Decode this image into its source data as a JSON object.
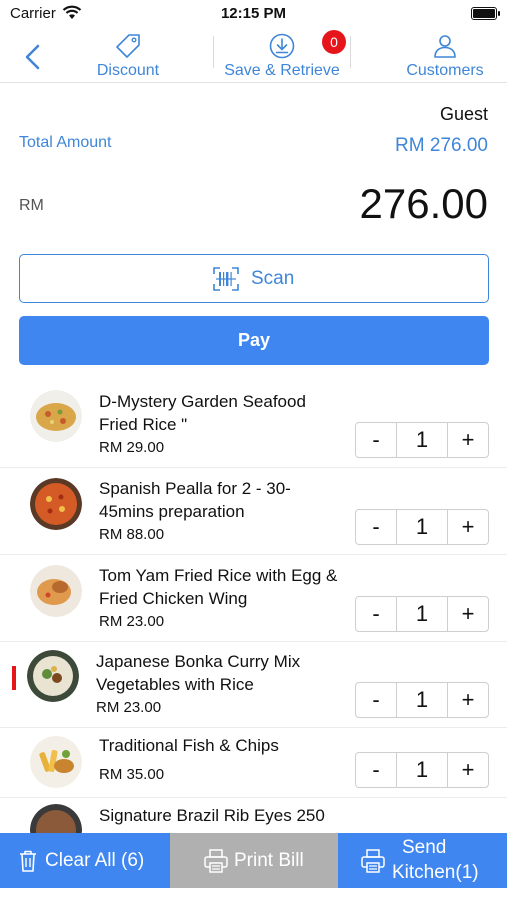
{
  "status_bar": {
    "carrier": "Carrier",
    "time": "12:15 PM"
  },
  "nav": {
    "discount_label": "Discount",
    "save_retrieve_label": "Save & Retrieve",
    "save_retrieve_badge": "0",
    "customers_label": "Customers"
  },
  "summary": {
    "customer": "Guest",
    "total_label": "Total Amount",
    "total_amount": "RM 276.00",
    "currency": "RM",
    "big_amount": "276.00"
  },
  "actions": {
    "scan_label": "Scan",
    "pay_label": "Pay"
  },
  "items": [
    {
      "name": "D-Mystery Garden Seafood Fried Rice \"",
      "price": "RM 29.00",
      "qty": "1"
    },
    {
      "name": "Spanish Pealla for 2 - 30-45mins preparation",
      "price": "RM 88.00",
      "qty": "1"
    },
    {
      "name": "Tom Yam Fried Rice with Egg & Fried Chicken Wing",
      "price": "RM 23.00",
      "qty": "1"
    },
    {
      "name": "Japanese Bonka Curry Mix Vegetables with Rice",
      "price": "RM 23.00",
      "qty": "1"
    },
    {
      "name": "Traditional Fish & Chips",
      "price": "RM 35.00",
      "qty": "1"
    },
    {
      "name": "Signature Brazil Rib Eyes 250",
      "price": "",
      "qty": ""
    }
  ],
  "stepper": {
    "minus": "-",
    "plus": "+"
  },
  "bottom_bar": {
    "clear_all": "Clear All (6)",
    "print_bill": "Print Bill",
    "send_kitchen_line1": "Send",
    "send_kitchen_line2": "Kitchen(1)"
  },
  "colors": {
    "accent": "#3f86f0",
    "link": "#3f86d8",
    "badge": "#e6141b",
    "disabled": "#b0b0b0"
  }
}
